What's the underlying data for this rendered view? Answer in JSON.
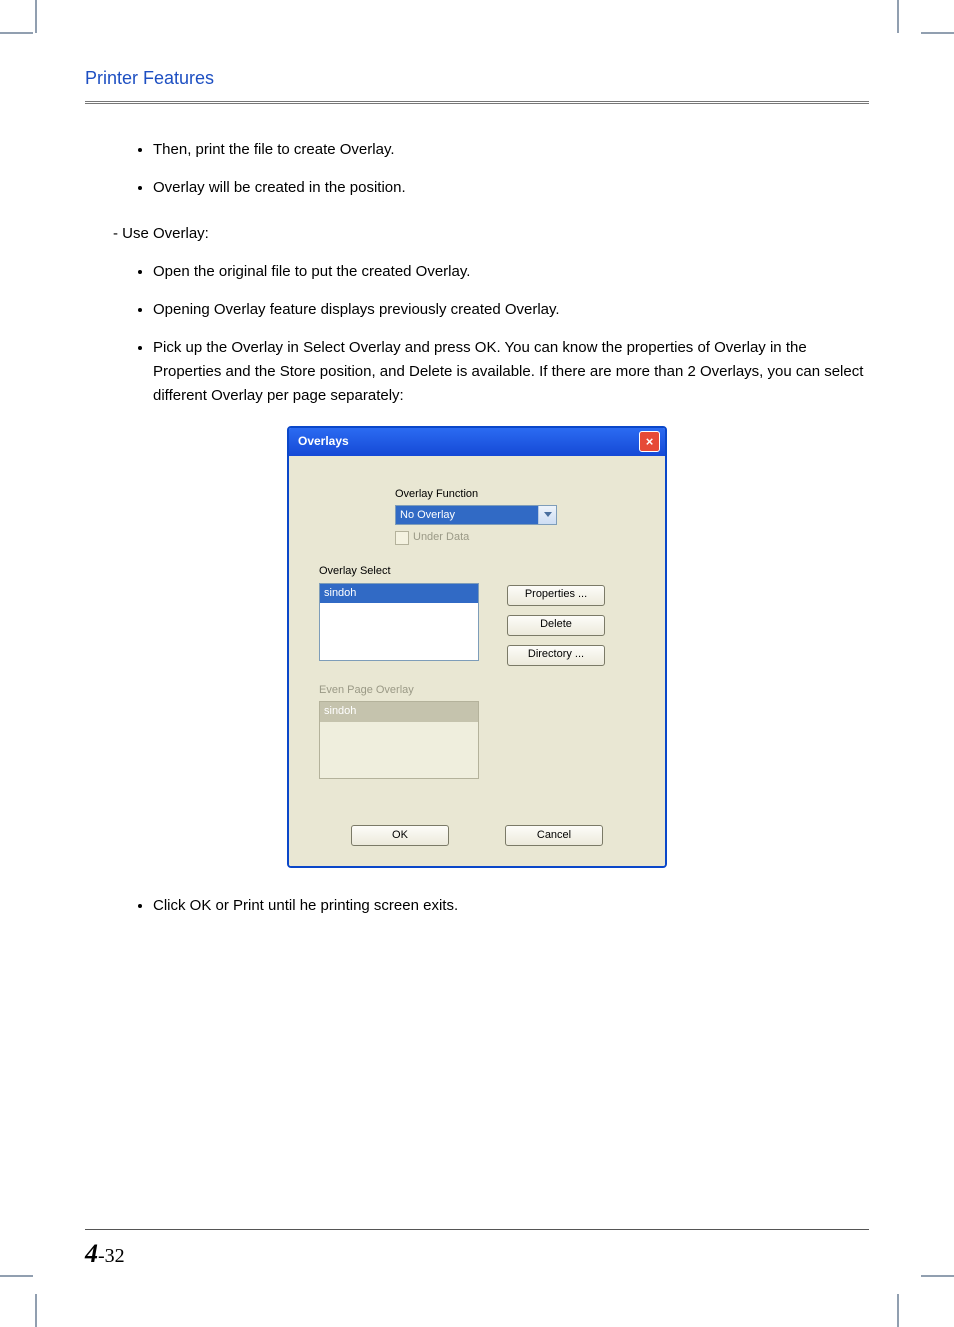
{
  "header": {
    "title": "Printer Features"
  },
  "intro_bullets": [
    "Then, print the file to create Overlay.",
    "Overlay will be created in the position."
  ],
  "use_overlay": {
    "heading": "- Use Overlay:",
    "bullets": [
      "Open the original file to put the created Overlay.",
      "Opening Overlay feature displays previously created Overlay.",
      "Pick up the Overlay in Select Overlay and press OK. You can know the properties of Overlay in the Properties and the Store position, and Delete is available. If there are more than 2 Overlays, you can select different Overlay per page separately:"
    ]
  },
  "dialog": {
    "title": "Overlays",
    "overlay_function_label": "Overlay Function",
    "overlay_function_value": "No Overlay",
    "under_data_label": "Under Data",
    "overlay_select_label": "Overlay Select",
    "overlay_select_item": "sindoh",
    "even_page_label": "Even Page Overlay",
    "even_page_item": "sindoh",
    "buttons": {
      "properties": "Properties ...",
      "delete": "Delete",
      "directory": "Directory ...",
      "ok": "OK",
      "cancel": "Cancel"
    }
  },
  "after_bullets": [
    "Click OK or Print until he printing screen exits."
  ],
  "footer": {
    "chapter": "4",
    "page": "-32"
  }
}
